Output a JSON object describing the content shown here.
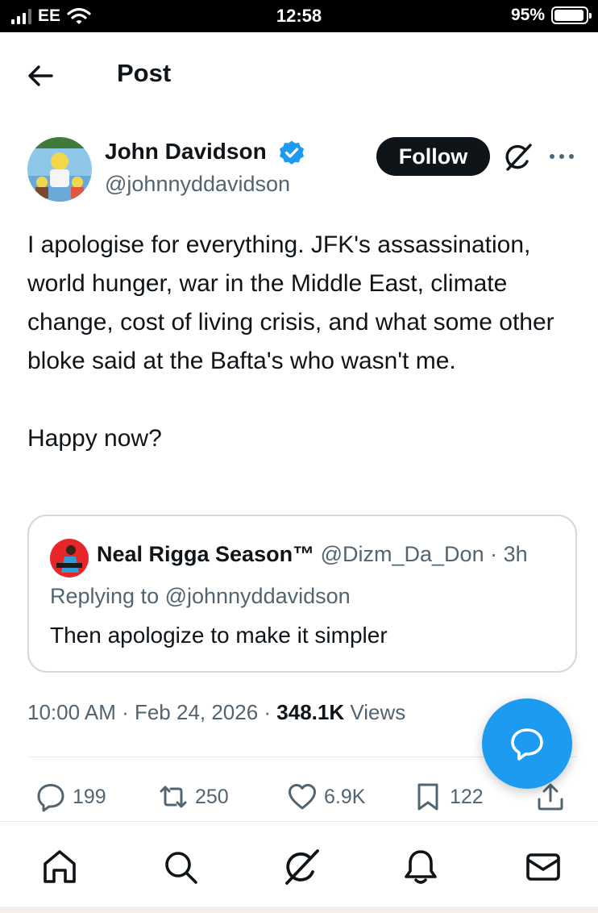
{
  "status_bar": {
    "carrier": "EE",
    "time": "12:58",
    "battery": "95%",
    "battery_level": 0.95
  },
  "header": {
    "title": "Post"
  },
  "post": {
    "author_name": "John Davidson",
    "author_handle": "@johnnyddavidson",
    "verified": true,
    "follow_label": "Follow",
    "text": "I apologise for everything. JFK's assassination, world hunger, war in the Middle East, climate change, cost of living crisis, and what some other bloke said at the Bafta's who wasn't me.\n\nHappy now?",
    "quote": {
      "name": "Neal Rigga Season™",
      "handle_time": "@Dizm_Da_Don · 3h",
      "replying_to": "Replying to @johnnyddavidson",
      "text": "Then apologize to make it simpler"
    },
    "timestamp": "10:00 AM · Feb 24, 2026 · ",
    "views_count": "348.1K",
    "views_label": " Views"
  },
  "actions": {
    "replies": "199",
    "reposts": "250",
    "likes": "6.9K",
    "bookmarks": "122"
  },
  "icons": {
    "back": "arrow-left-icon",
    "verified": "verified-badge-icon",
    "grok": "grok-icon",
    "more": "more-dots-icon",
    "reply": "reply-icon",
    "repost": "repost-icon",
    "like": "heart-icon",
    "bookmark": "bookmark-icon",
    "share": "share-icon",
    "compose": "compose-reply-icon",
    "nav_home": "home-icon",
    "nav_search": "search-icon",
    "nav_grok": "grok-icon",
    "nav_notifications": "bell-icon",
    "nav_messages": "mail-icon"
  },
  "colors": {
    "accent": "#1d9bf0",
    "text": "#0f1419",
    "secondary": "#536471",
    "border": "#cfd9de"
  }
}
